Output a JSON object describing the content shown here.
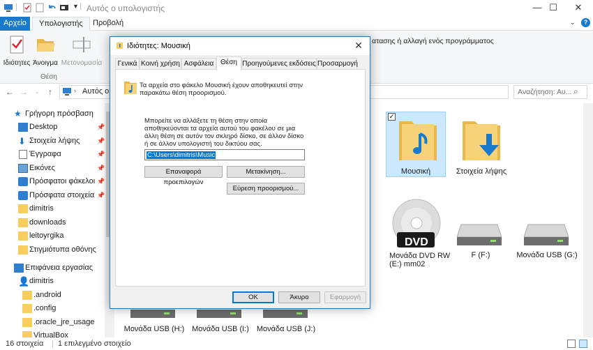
{
  "window": {
    "title": "Αυτός ο υπολογιστής",
    "minimize": "—",
    "maximize": "☐",
    "close": "✕"
  },
  "ribbon": {
    "tabs": {
      "file": "Αρχείο",
      "computer": "Υπολογιστής",
      "view": "Προβολή"
    },
    "buttons": {
      "properties": "Ιδιότητες",
      "open": "Άνοιγμα",
      "rename": "Μετονομασία"
    },
    "group_label": "Θέση",
    "right_text": "ατασης ή αλλαγή ενός προγράμματος"
  },
  "address": {
    "path": "Αυτός ο",
    "search_placeholder": "Αναζήτηση: Αυ...",
    "search_icon": "⌕"
  },
  "nav": {
    "items": [
      {
        "label": "Γρήγορη πρόσβαση",
        "pin": ""
      },
      {
        "label": "Desktop",
        "pin": "📌"
      },
      {
        "label": "Στοιχεία λήψης",
        "pin": "📌"
      },
      {
        "label": "Έγγραφα",
        "pin": "📌"
      },
      {
        "label": "Εικόνες",
        "pin": "📌"
      },
      {
        "label": "Πρόσφατοι φάκελοι",
        "pin": "📌"
      },
      {
        "label": "Πρόσφατα στοιχεία",
        "pin": "📌"
      },
      {
        "label": "dimitris",
        "pin": ""
      },
      {
        "label": "downloads",
        "pin": ""
      },
      {
        "label": "leitoyrgika",
        "pin": ""
      },
      {
        "label": "Στιγμιότυπα οθόνης",
        "pin": ""
      },
      {
        "label": "Επιφάνεια εργασίας",
        "pin": ""
      },
      {
        "label": "dimitris",
        "pin": ""
      },
      {
        "label": ".android",
        "pin": ""
      },
      {
        "label": ".config",
        "pin": ""
      },
      {
        "label": ".oracle_jre_usage",
        "pin": ""
      },
      {
        "label": "VirtualBox",
        "pin": ""
      }
    ]
  },
  "content": {
    "music": "Μουσική",
    "downloads": "Στοιχεία λήψης",
    "dvd_line1": "Μονάδα DVD RW",
    "dvd_line2": "(E:) mm02",
    "dvd_badge": "DVD",
    "drive_f": "F (F:)",
    "usb_g": "Μονάδα USB (G:)",
    "usb_h": "Μονάδα USB (H:)",
    "usb_i": "Μονάδα USB (I:)",
    "usb_j": "Μονάδα USB (J:)"
  },
  "status": {
    "count": "16 στοιχεία",
    "selected": "1 επιλεγμένο στοιχείο"
  },
  "dialog": {
    "title": "Ιδιότητες: Μουσική",
    "tabs": [
      "Γενικά",
      "Κοινή χρήση",
      "Ασφάλεια",
      "Θέση",
      "Προηγούμενες εκδόσεις",
      "Προσαρμογή"
    ],
    "info_line1": "Τα αρχεία στο φάκελο Μουσική έχουν αποθηκευτεί στην",
    "info_line2": "παρακάτω θέση προορισμού.",
    "desc_line1": "Μπορείτε να αλλάξετε τη θέση στην οποία",
    "desc_line2": "αποθηκεύονται τα αρχεία αυτού του φακέλου σε μια",
    "desc_line3": "άλλη θέση σε αυτόν τον σκληρό δίσκο, σε άλλον δίσκο",
    "desc_line4": "ή σε άλλον υπολογιστή του δικτύου σας.",
    "path_value": "C:\\Users\\dimitris\\Music",
    "restore_button": "Επαναφορά προεπιλογών",
    "move_button": "Μετακίνηση...",
    "find_button": "Εύρεση προορισμού...",
    "ok_button": "OK",
    "cancel_button": "Άκυρο",
    "apply_button": "Εφαρμογή"
  }
}
